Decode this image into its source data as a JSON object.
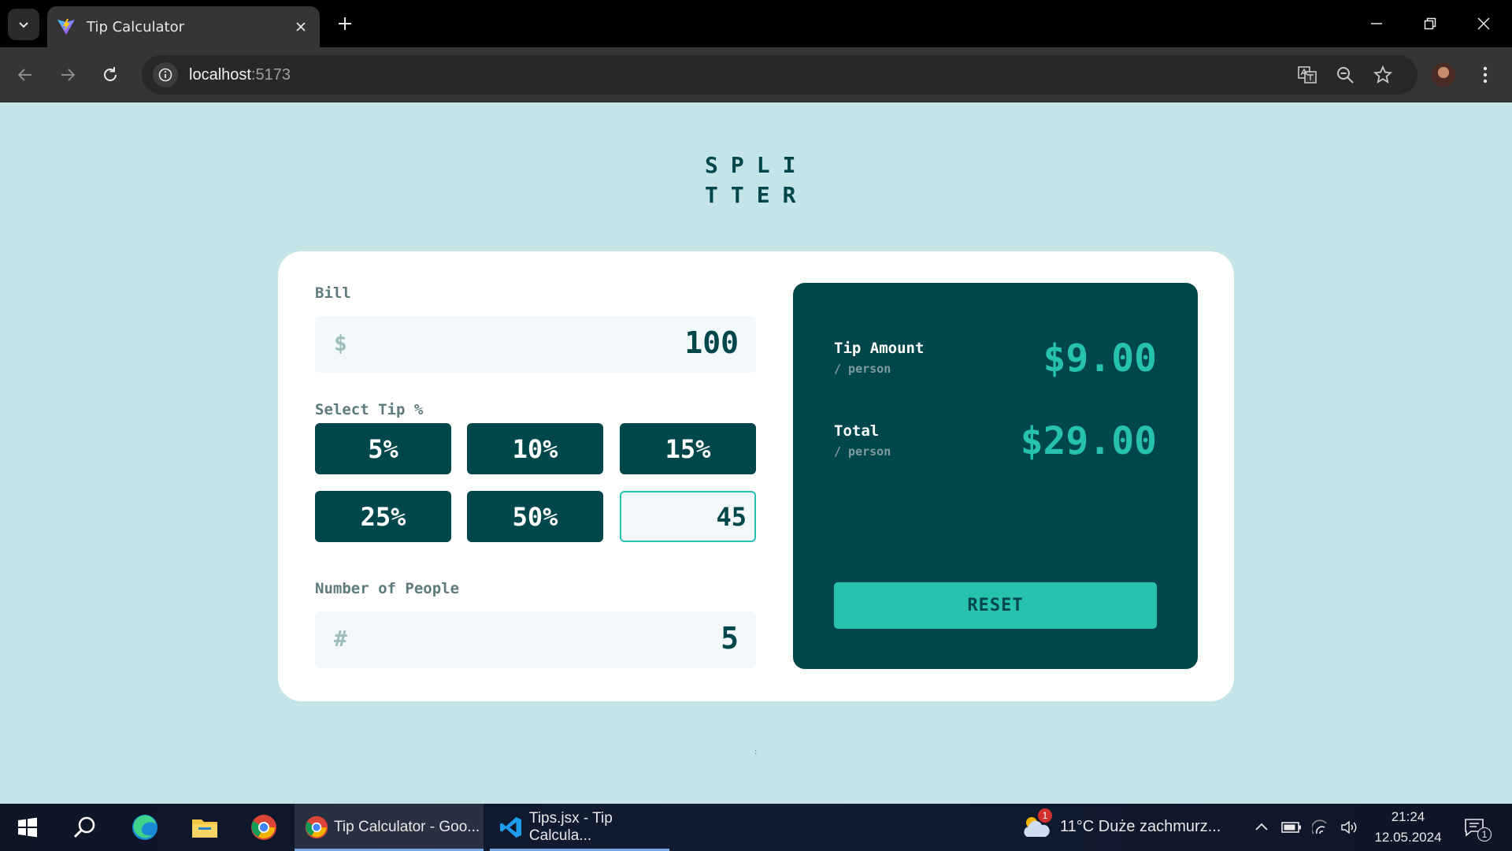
{
  "browser": {
    "tab_title": "Tip Calculator",
    "url_host": "localhost",
    "url_port": ":5173"
  },
  "app": {
    "logo_line1": "SPLI",
    "logo_line2": "TTER",
    "bill": {
      "label": "Bill",
      "icon": "dollar-icon",
      "value": "100"
    },
    "tip": {
      "label": "Select Tip %",
      "options": [
        "5%",
        "10%",
        "15%",
        "25%",
        "50%"
      ],
      "custom_value": "45"
    },
    "people": {
      "label": "Number of People",
      "icon": "hash-icon",
      "value": "5"
    },
    "results": {
      "tip_label": "Tip Amount",
      "tip_sub": "/ person",
      "tip_value": "$9.00",
      "total_label": "Total",
      "total_sub": "/ person",
      "total_value": "$29.00",
      "reset_label": "RESET"
    },
    "footer_mark": ":"
  },
  "taskbar": {
    "apps": [
      {
        "label": "Tip Calculator - Goo..."
      },
      {
        "label": "Tips.jsx - Tip Calcula..."
      }
    ],
    "weather_badge": "1",
    "weather_text": "11°C  Duże zachmurz...",
    "time": "21:24",
    "date": "12.05.2024",
    "notification_count": "1"
  },
  "colors": {
    "page_bg": "#c5e4e7",
    "dark_cyan": "#00474b",
    "strong_cyan": "#26c2ae",
    "input_bg": "#f3f9fa",
    "label_gray": "#5e7a7d"
  }
}
